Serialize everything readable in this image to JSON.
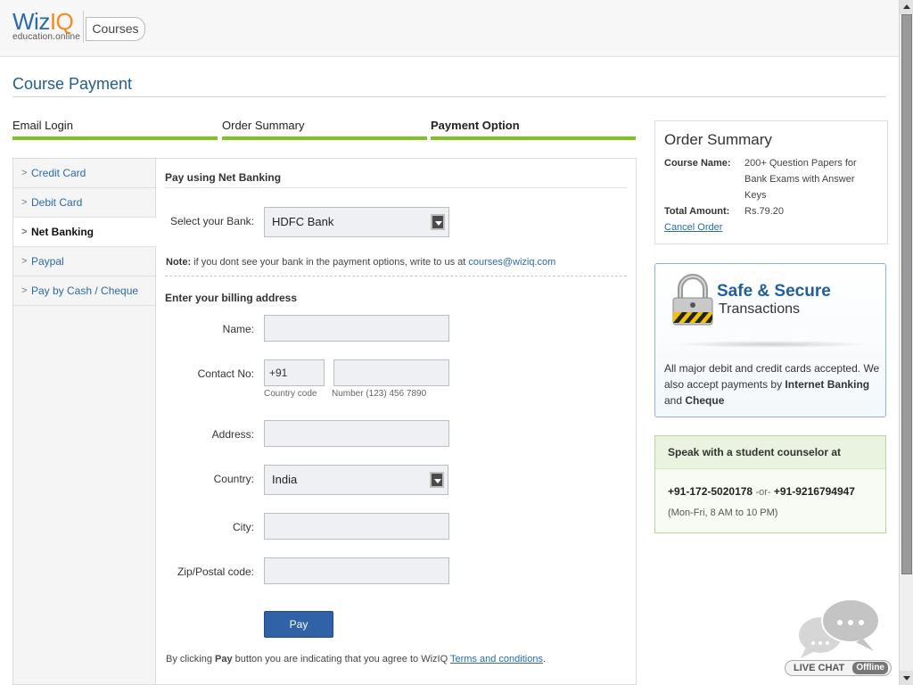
{
  "header": {
    "logo_wiz": "Wiz",
    "logo_iq": "IQ",
    "logo_sub": "education.online",
    "courses_tab": "Courses"
  },
  "page_title": "Course Payment",
  "steps": [
    {
      "label": "Email Login",
      "active": false
    },
    {
      "label": "Order Summary",
      "active": false
    },
    {
      "label": "Payment Option",
      "active": true
    }
  ],
  "payment_methods": [
    {
      "label": "Credit Card",
      "active": false
    },
    {
      "label": "Debit Card",
      "active": false
    },
    {
      "label": "Net Banking",
      "active": true
    },
    {
      "label": "Paypal",
      "active": false
    },
    {
      "label": "Pay by Cash / Cheque",
      "active": false
    }
  ],
  "net_banking": {
    "heading": "Pay using Net Banking",
    "bank_label": "Select your Bank:",
    "bank_value": "HDFC Bank",
    "note_prefix": "Note:",
    "note_text": "if you dont see your bank in the payment options, write to us at",
    "note_email": "courses@wiziq.com"
  },
  "billing": {
    "heading": "Enter your billing address",
    "name_label": "Name:",
    "name_value": "",
    "contact_label": "Contact No:",
    "country_code_value": "+91",
    "country_code_hint": "Country code",
    "number_value": "",
    "number_hint": "Number (123) 456 7890",
    "address_label": "Address:",
    "address_value": "",
    "country_label": "Country:",
    "country_value": "India",
    "city_label": "City:",
    "city_value": "",
    "zip_label": "Zip/Postal code:",
    "zip_value": ""
  },
  "pay_button": "Pay",
  "agreement": {
    "prefix": "By clicking",
    "bold": "Pay",
    "middle": "button you are indicating that you agree to WizIQ",
    "link": "Terms and conditions",
    "suffix": "."
  },
  "order_summary": {
    "title": "Order Summary",
    "course_label": "Course Name:",
    "course_value": "200+ Question Papers for Bank Exams with Answer Keys",
    "amount_label": "Total Amount:",
    "amount_value": "Rs.79.20",
    "cancel": "Cancel Order"
  },
  "secure": {
    "title": "Safe & Secure",
    "subtitle": "Transactions",
    "text_1": "All major debit and credit cards accepted. We also accept payments by",
    "bold_1": "Internet Banking",
    "text_2": "and",
    "bold_2": "Cheque"
  },
  "counselor": {
    "heading": "Speak with a student counselor at",
    "phone_1": "+91-172-5020178",
    "or": "-or-",
    "phone_2": "+91-9216794947",
    "hours": "(Mon-Fri, 8 AM to 10 PM)"
  },
  "live_chat": {
    "label": "LIVE CHAT",
    "status": "Offline"
  },
  "colors": {
    "brand_blue": "#2a6aa8",
    "brand_orange": "#f28c1e",
    "step_green": "#7ec321",
    "pay_button": "#2f62a6"
  }
}
